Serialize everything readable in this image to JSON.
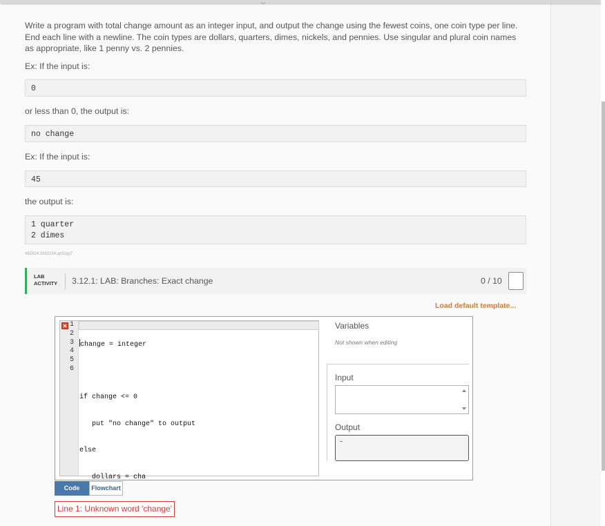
{
  "description": "Write a program with total change amount as an integer input, and output the change using the fewest coins, one coin type per line. End each line with a newline. The coin types are dollars, quarters, dimes, nickels, and pennies. Use singular and plural coin names as appropriate, like 1 penny vs. 2 pennies.",
  "examples": {
    "ex1_label": "Ex: If the input is:",
    "ex1_input": "0",
    "ex1_mid": "or less than 0, the output is:",
    "ex1_output": "no change",
    "ex2_label": "Ex: If the input is:",
    "ex2_input": "45",
    "ex2_mid": "the output is:",
    "ex2_output": "1 quarter\n2 dimes"
  },
  "activity_id": "482624.3393194.qx3zqy7",
  "lab": {
    "tag_line1": "LAB",
    "tag_line2": "ACTIVITY",
    "title": "3.12.1: LAB: Branches: Exact change",
    "score": "0 / 10",
    "load_template": "Load default template..."
  },
  "editor": {
    "error_marker": "✕",
    "line_numbers": [
      "1",
      "2",
      "3",
      "4",
      "5",
      "6"
    ],
    "lines": [
      "change = integer",
      "",
      "if change <= 0",
      "   put \"no change\" to output",
      "else",
      "   dollars = cha"
    ]
  },
  "io": {
    "variables_label": "Variables",
    "variables_note": "Not shown when editing",
    "input_label": "Input",
    "output_label": "Output"
  },
  "tabs": {
    "code": "Code",
    "flowchart": "Flowchart"
  },
  "error_message": "Line 1: Unknown word 'change'"
}
